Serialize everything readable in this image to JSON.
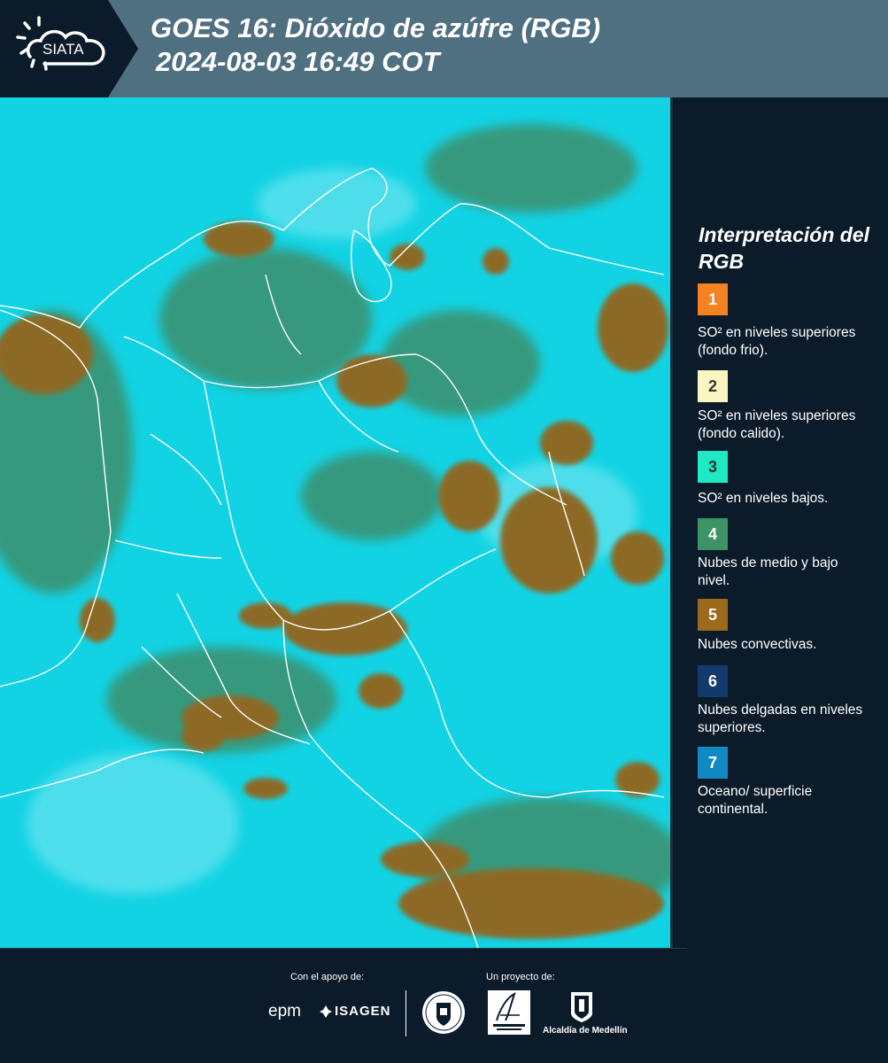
{
  "header": {
    "logo_text": "SIATA",
    "title_line1": "GOES 16: Dióxido de azúfre (RGB)",
    "title_line2": "2024-08-03 16:49 COT"
  },
  "map": {
    "description_icon": "satellite-rgb-map",
    "colors": {
      "background": "#0ed3e6",
      "convective": "#8a6a2a",
      "mid_low_cloud": "#3f8a6a",
      "borders": "#ffffff"
    }
  },
  "legend": {
    "title": "Interpretación del RGB",
    "items": [
      {
        "number": "1",
        "label": "SO² en niveles superiores (fondo frio).",
        "color": "#f58220",
        "text_color": "#ffffff"
      },
      {
        "number": "2",
        "label": "SO² en niveles superiores (fondo calido).",
        "color": "#fdf5c0",
        "text_color": "#333333"
      },
      {
        "number": "3",
        "label": "SO² en niveles bajos.",
        "color": "#1de9c4",
        "text_color": "#333333"
      },
      {
        "number": "4",
        "label": "Nubes de medio y bajo nivel.",
        "color": "#3c9466",
        "text_color": "#ffffff"
      },
      {
        "number": "5",
        "label": "Nubes convectivas.",
        "color": "#9c6a1c",
        "text_color": "#ffffff"
      },
      {
        "number": "6",
        "label": "Nubes delgadas en niveles superiores.",
        "color": "#123a6c",
        "text_color": "#ffffff"
      },
      {
        "number": "7",
        "label": "Oceano/ superficie continental.",
        "color": "#1189c2",
        "text_color": "#ffffff"
      }
    ]
  },
  "footer": {
    "support_label": "Con el apoyo de:",
    "project_label": "Un proyecto de:",
    "epm": "epm",
    "isagen": "ISAGEN",
    "alcaldia": "Alcaldía de Medellín"
  }
}
